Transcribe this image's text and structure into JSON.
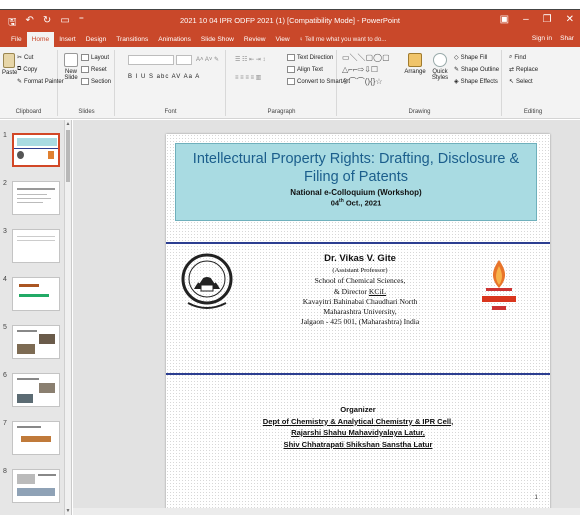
{
  "window": {
    "title": "2021 10 04 IPR ODFP 2021 (1) [Compatibility Mode] - PowerPoint"
  },
  "tabs": [
    {
      "label": "File"
    },
    {
      "label": "Home",
      "active": true
    },
    {
      "label": "Insert"
    },
    {
      "label": "Design"
    },
    {
      "label": "Transitions"
    },
    {
      "label": "Animations"
    },
    {
      "label": "Slide Show"
    },
    {
      "label": "Review"
    },
    {
      "label": "View"
    }
  ],
  "tell_me": "♀ Tell me what you want to do...",
  "account": {
    "sign_in": "Sign in",
    "share": "Shar"
  },
  "ribbon": {
    "clipboard": {
      "label": "Clipboard",
      "paste": "Paste",
      "cut": "Cut",
      "copy": "Copy",
      "format_painter": "Format Painter"
    },
    "slides": {
      "label": "Slides",
      "new_slide": "New Slide",
      "layout": "Layout",
      "reset": "Reset",
      "section": "Section"
    },
    "font": {
      "label": "Font",
      "tools": "B  I  U  S  abc  AV  Aa  A"
    },
    "paragraph": {
      "label": "Paragraph",
      "text_direction": "Text Direction",
      "align_text": "Align Text",
      "convert": "Convert to SmartArt"
    },
    "drawing": {
      "label": "Drawing",
      "arrange": "Arrange",
      "quick_styles": "Quick Styles",
      "shape_fill": "Shape Fill",
      "shape_outline": "Shape Outline",
      "shape_effects": "Shape Effects"
    },
    "editing": {
      "label": "Editing",
      "find": "Find",
      "replace": "Replace",
      "select": "Select"
    }
  },
  "thumbnails": [
    "1",
    "2",
    "3",
    "4",
    "5",
    "6",
    "7",
    "8"
  ],
  "slide": {
    "title_line1": "Intellectural Property Rights: Drafting, Disclosure &",
    "title_line2": "Filing of Patents",
    "subtitle": "National e-Colloquium (Workshop)",
    "date_main": "04",
    "date_sup": "th",
    "date_rest": " Oct., 2021",
    "name": "Dr. Vikas V. Gite",
    "role": "(Assistant Professor)",
    "dept": "School of Chemical Sciences,",
    "director_prefix": "& Director ",
    "director_kcil": "KCiL",
    "univ1": "Kavayitri Bahinabai Chaudhari North",
    "univ2": "Maharashtra University,",
    "address": "Jalgaon - 425 001, (Maharashtra) India",
    "org_heading": "Organizer",
    "org1": "Dept of Chemistry & Analytical Chemistry & IPR Cell,",
    "org2": "Rajarshi Shahu Mahavidyalaya Latur,",
    "org3": "Shiv Chhatrapati Shikshan Sanstha Latur",
    "page": "1"
  },
  "colors": {
    "accent": "#c9482a",
    "banner": "#a9dbe2",
    "title_blue": "#1b5e8c",
    "rule": "#2c3e91"
  }
}
